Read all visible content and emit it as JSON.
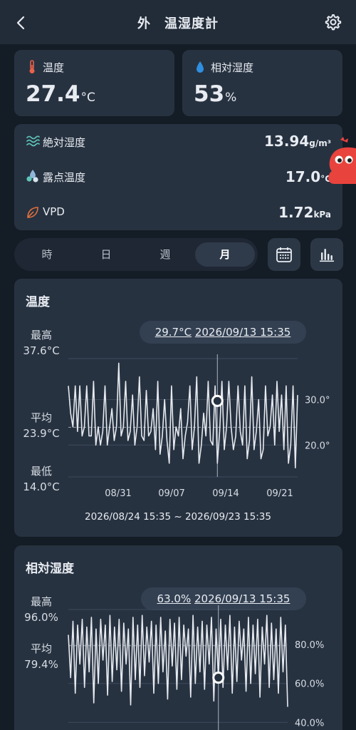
{
  "header": {
    "title": "外　温湿度計",
    "back_icon": "chevron-left-icon",
    "settings_icon": "gear-icon"
  },
  "top_cards": {
    "temperature": {
      "label": "温度",
      "value": "27.4",
      "unit": "°C",
      "icon": "thermometer-icon",
      "icon_color": "#e8614a"
    },
    "humidity": {
      "label": "相対湿度",
      "value": "53",
      "unit": "%",
      "icon": "water-drop-icon",
      "icon_color": "#2f8fe0"
    }
  },
  "details": {
    "absolute_humidity": {
      "label": "絶対湿度",
      "value": "13.94",
      "unit": "g/m³",
      "icon": "wave-icon"
    },
    "dew_point": {
      "label": "露点温度",
      "value": "17.0",
      "unit": "°C",
      "icon": "dew-drops-icon"
    },
    "vpd": {
      "label": "VPD",
      "value": "1.72",
      "unit": "kPa",
      "icon": "leaf-icon"
    }
  },
  "segments": {
    "items": [
      "時",
      "日",
      "週",
      "月"
    ],
    "selected": "月"
  },
  "buttons": {
    "calendar_icon": "calendar-icon",
    "chart_icon": "bar-chart-icon"
  },
  "temp_chart": {
    "title": "温度",
    "max_label": "最高",
    "max_value": "37.6°C",
    "avg_label": "平均",
    "avg_value": "23.9°C",
    "min_label": "最低",
    "min_value": "14.0°C",
    "tooltip_value": "29.7°C",
    "tooltip_date": "2026/09/13 15:35",
    "range": "2026/08/24 15:35 ~ 2026/09/23 15:35"
  },
  "humidity_chart": {
    "title": "相対湿度",
    "max_label": "最高",
    "max_value": "96.0%",
    "avg_label": "平均",
    "avg_value": "79.4%",
    "tooltip_value": "63.0%",
    "tooltip_date": "2026/09/13 15:35"
  },
  "chart_data": [
    {
      "type": "line",
      "title": "温度",
      "x_ticks": [
        "08/31",
        "09/07",
        "09/14",
        "09/21"
      ],
      "y_ticks": [
        "30.0°",
        "20.0°"
      ],
      "y_tick_values": [
        30,
        20
      ],
      "ylim": [
        13,
        39
      ],
      "average": 23.9,
      "line_color": "#e6e9ee",
      "series": [
        {
          "values": [
            33,
            27,
            24,
            33,
            23,
            33,
            22,
            24,
            33,
            22,
            22,
            34,
            20,
            24,
            20,
            23,
            33,
            20,
            24,
            28,
            21,
            24,
            38,
            22,
            24,
            34,
            21,
            23,
            31,
            20,
            24,
            35,
            22,
            21,
            32,
            22,
            23,
            28,
            19,
            34,
            18,
            22,
            30,
            21,
            16,
            33,
            19,
            24,
            22,
            28,
            17,
            22,
            25,
            33,
            19,
            24,
            35,
            16,
            20,
            27,
            22,
            34,
            21,
            20,
            33,
            16,
            23,
            34,
            19,
            24,
            34,
            24,
            19,
            22,
            33,
            23,
            20,
            33,
            17,
            21,
            35,
            19,
            23,
            30,
            17,
            19,
            33,
            22,
            24,
            31,
            20,
            34,
            23,
            31,
            19,
            33,
            16,
            20,
            33,
            15,
            31
          ]
        }
      ],
      "tooltip_point": {
        "x": "09/13",
        "y": 29.7
      }
    },
    {
      "type": "line",
      "title": "相対湿度",
      "y_ticks": [
        "80.0%",
        "60.0%",
        "40.0%"
      ],
      "y_tick_values": [
        80,
        60,
        40
      ],
      "ylim": [
        35,
        98
      ],
      "average": 79.4,
      "line_color": "#e6e9ee",
      "series": [
        {
          "values": [
            85,
            63,
            92,
            55,
            90,
            70,
            93,
            58,
            89,
            66,
            94,
            50,
            88,
            60,
            93,
            72,
            90,
            54,
            95,
            61,
            89,
            67,
            93,
            56,
            91,
            70,
            88,
            49,
            94,
            62,
            90,
            58,
            95,
            64,
            89,
            71,
            92,
            55,
            90,
            60,
            94,
            66,
            87,
            52,
            93,
            69,
            91,
            57,
            94,
            62,
            90,
            74,
            88,
            53,
            95,
            60,
            89,
            66,
            92,
            57,
            90,
            70,
            94,
            51,
            88,
            63,
            93,
            58,
            90,
            67,
            95,
            55,
            89,
            61,
            92,
            72,
            88,
            56,
            94,
            60,
            90,
            65,
            93,
            53,
            89,
            70,
            95,
            58,
            91,
            62,
            88,
            55,
            94,
            66,
            90,
            48
          ]
        }
      ],
      "tooltip_point": {
        "x": "09/13",
        "y": 63.0
      }
    }
  ]
}
